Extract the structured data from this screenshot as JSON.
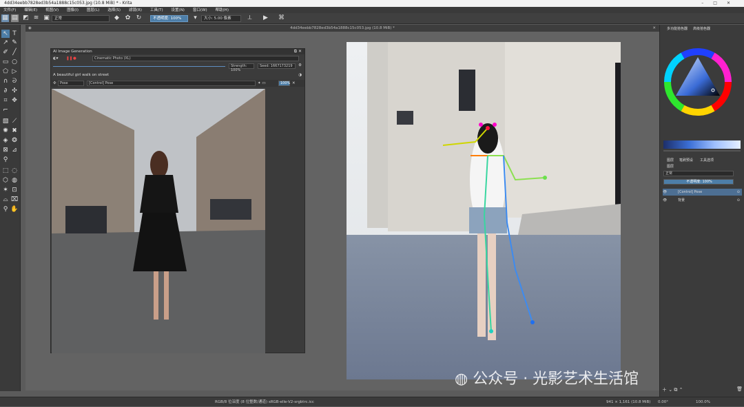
{
  "window": {
    "title": "4dd34eebb7828ed3b54a1888c15c053.jpg (10.8 MiB) * - Krita",
    "controls": [
      "–",
      "□",
      "✕"
    ]
  },
  "menu": [
    "文件(F)",
    "编辑(E)",
    "视图(V)",
    "图像(I)",
    "图层(L)",
    "选择(S)",
    "滤镜(R)",
    "工具(T)",
    "设置(N)",
    "窗口(W)",
    "帮助(H)"
  ],
  "toolbar": {
    "blend_mode": "正常",
    "opacity": "不透明度: 100%",
    "size_label": "大小:",
    "size_value": "5.00 像素"
  },
  "document": {
    "tab_title": "4dd34eebb7828ed3b54a1888c15c053.jpg (10.8 MiB) *"
  },
  "ai_panel": {
    "title": "AI Image Generation",
    "style": "Cinematic Photo (XL)",
    "strength": "Strength: 100%",
    "seed": "Seed: 1667173219",
    "prompt": "A beautiful girl walk on street",
    "control_type": "Pose",
    "control_layer": "[Control] Pose",
    "control_strength": "100%"
  },
  "right_dock": {
    "tabs_top": [
      "多功能拾色器",
      "高级拾色器"
    ],
    "tabs_bottom": [
      "图层",
      "笔刷预设",
      "工具选项"
    ],
    "layer_panel_title": "图层",
    "blend": "正常",
    "opacity": "不透明度: 100%",
    "layers": [
      {
        "name": "[Control] Pose"
      },
      {
        "name": "背景"
      }
    ]
  },
  "status": {
    "color_space": "RGB/8 位深度 (8 位整数/通道) sRGB-elle-V2-srgbtrc.icc",
    "dimensions": "941 × 1,161 (10.8 MiB)",
    "angle": "0.00°",
    "zoom": "100.0%"
  },
  "watermark": "公众号 · 光影艺术生活馆",
  "colors": {
    "accent": "#4d7ea8",
    "panel": "#3b3b3b",
    "canvas": "#636363"
  }
}
